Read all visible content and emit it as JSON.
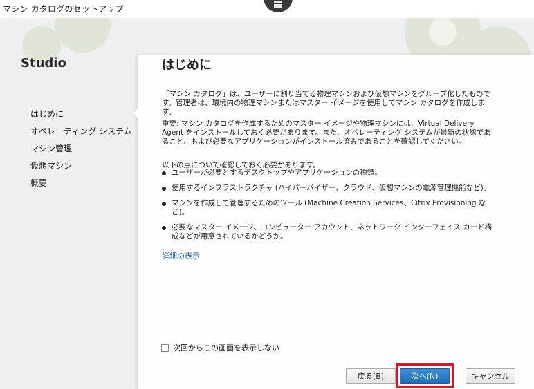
{
  "window": {
    "title": "マシン カタログのセットアップ"
  },
  "sidebar": {
    "brand": "Studio",
    "steps": [
      {
        "label": "はじめに",
        "active": true
      },
      {
        "label": "オペレーティング システム",
        "active": false
      },
      {
        "label": "マシン管理",
        "active": false
      },
      {
        "label": "仮想マシン",
        "active": false
      },
      {
        "label": "概要",
        "active": false
      }
    ]
  },
  "main": {
    "heading": "はじめに",
    "intro": "「マシン カタログ」は、ユーザーに割り当てる物理マシンおよび仮想マシンをグループ化したものです。管理者は、環境内の物理マシンまたはマスター イメージを使用してマシン カタログを作成します。",
    "important": "重要: マシン カタログを作成するためのマスター イメージや物理マシンには、Virtual Delivery Agent をインストールしておく必要があります。また、オペレーティング システムが最新の状態であること、および必要なアプリケーションがインストール済みであることを確認してください。",
    "checklist_intro": "以下の点について確認しておく必要があります。",
    "checklist": [
      "ユーザーが必要とするデスクトップやアプリケーションの種類。",
      "使用するインフラストラクチャ (ハイパーバイザー、クラウド、仮想マシンの電源管理機能など)。",
      "マシンを作成して管理するためのツール (Machine Creation Services、Citrix Provisioning など)。",
      "必要なマスター イメージ、コンピューター アカウント、ネットワーク インターフェイス カード構成などが用意されているかどうか。"
    ],
    "more_link": "詳細の表示",
    "dont_show_label": "次回からこの画面を表示しない",
    "dont_show_checked": false
  },
  "footer": {
    "back_label": "戻る(B)",
    "next_label": "次へ(N)",
    "cancel_label": "キャンセル"
  },
  "colors": {
    "accent": "#2a7fc9",
    "highlight_box": "#e0141e",
    "link": "#1a5fa8",
    "deco_green": "#b9cf9c"
  }
}
